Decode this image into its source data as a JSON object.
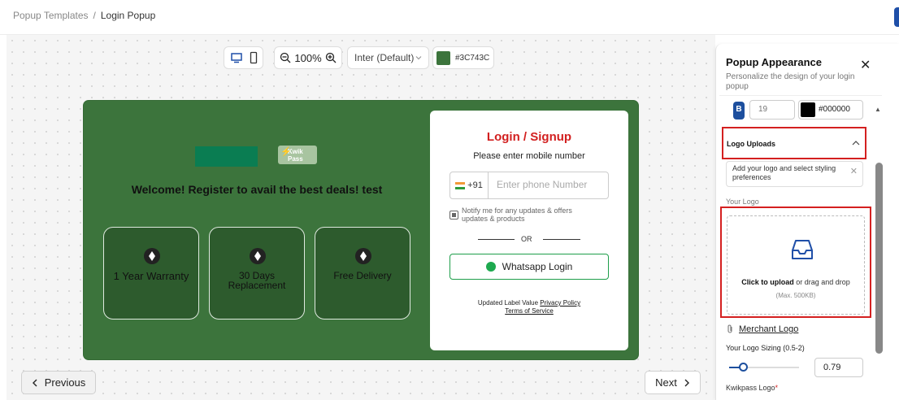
{
  "breadcrumb": {
    "parent": "Popup Templates",
    "sep": "/",
    "current": "Login Popup"
  },
  "toolbar": {
    "zoom": "100%",
    "font": "Inter (Default)",
    "color_hex": "#3C743C",
    "color": "#3C743C"
  },
  "popup": {
    "bg_color": "#3C743C",
    "logo_text": "Kwik Pass",
    "welcome": "Welcome! Register to avail the best deals! test",
    "features": [
      "1 Year Warranty",
      "30 Days Replacement",
      "Free Delivery"
    ]
  },
  "login": {
    "title": "Login / Signup",
    "subtitle": "Please enter mobile number",
    "country_code": "+91",
    "phone_placeholder": "Enter phone Number",
    "notify": "Notify me for any updates & offers updates & products",
    "or": "OR",
    "whatsapp": "Whatsapp Login",
    "legal_prefix": "Updated Label Value",
    "privacy": "Privacy Policy",
    "terms": "Terms of Service"
  },
  "nav": {
    "prev": "Previous",
    "next": "Next"
  },
  "panel": {
    "title": "Popup Appearance",
    "subtitle": "Personalize the design of your login popup",
    "bold_btn": "B",
    "font_size": "19",
    "text_color": "#000000",
    "logo_uploads": "Logo Uploads",
    "hint": "Add your logo and select styling preferences",
    "your_logo": "Your Logo",
    "upload_cta": "Click to upload",
    "upload_rest": " or drag and drop",
    "upload_max": "(Max. 500KB)",
    "merchant_logo": "Merchant Logo",
    "sizing_label": "Your Logo Sizing (0.5-2)",
    "sizing_value": "0.79",
    "kwikpass_logo": "Kwikpass Logo",
    "required_mark": "*"
  }
}
